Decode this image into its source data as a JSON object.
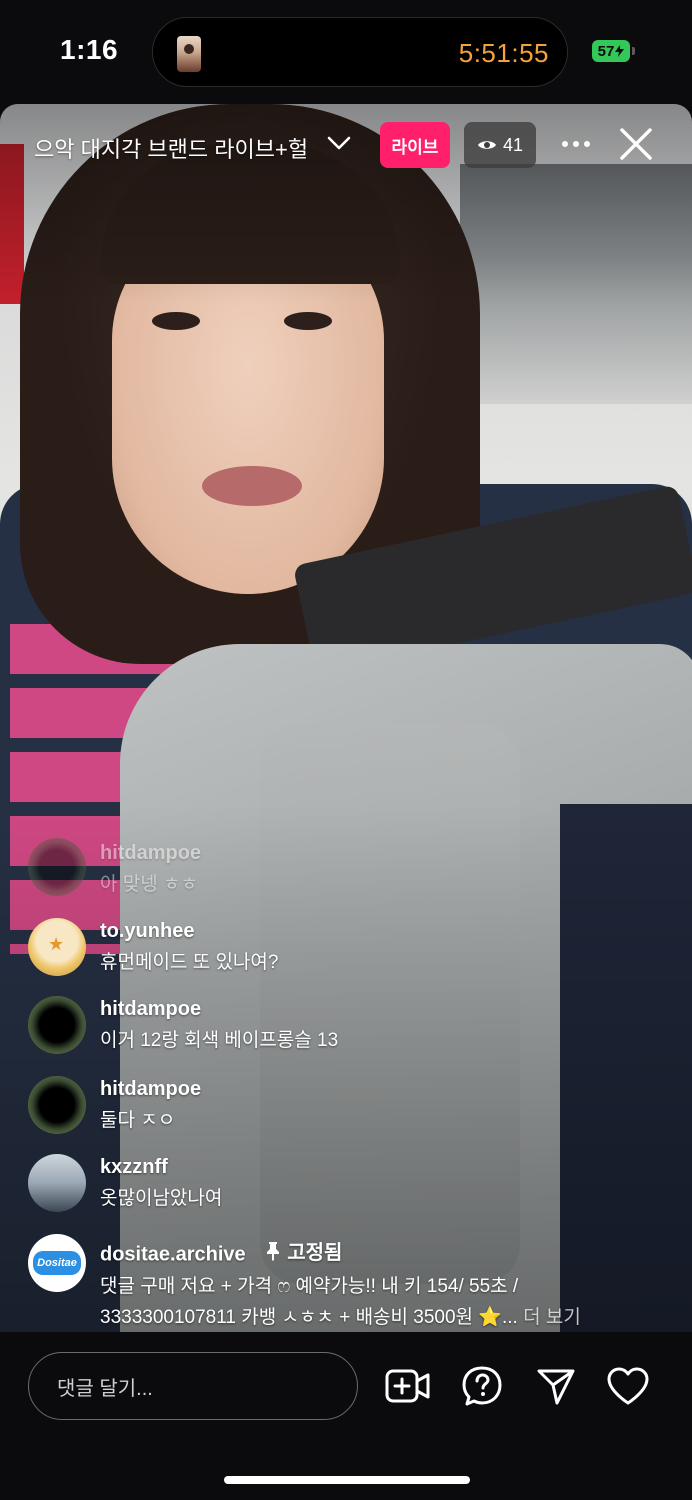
{
  "status_bar": {
    "time": "1:16",
    "activity_timer": "5:51:55",
    "battery_level": "57"
  },
  "live": {
    "title": "으악 대지각 브랜드 라이브+헐",
    "live_badge": "라이브",
    "viewer_count": "41",
    "accent_color": "#ff1f6b"
  },
  "comments": [
    {
      "username": "hitdampoe",
      "text": "아 맞넹 ㅎㅎ",
      "faded": true
    },
    {
      "username": "to.yunhee",
      "text": "휴먼메이드 또 있나여?"
    },
    {
      "username": "hitdampoe",
      "text": "이거 12랑 회색 베이프롱슬 13"
    },
    {
      "username": "hitdampoe",
      "text": "둘다 ㅈㅇ"
    },
    {
      "username": "kxzznff",
      "text": "옷많이남았나여"
    },
    {
      "username": "dositae.archive",
      "pinned_label": "고정됨",
      "text_line1": "댓글 구매 저요 + 가격 ෆ 예약가능!! 내 키 154/ 55초 /",
      "text_line2": "3333300107811 카뱅 ㅅㅎㅊ + 배송비 3500원 ⭐...",
      "more_label": "더 보기",
      "avatar_logo": "Dositae"
    }
  ],
  "bottom_bar": {
    "comment_placeholder": "댓글 달기..."
  },
  "icons": [
    "chevron-down-icon",
    "eye-icon",
    "more-icon",
    "close-icon",
    "pin-icon",
    "add-video-icon",
    "question-icon",
    "send-icon",
    "heart-icon"
  ]
}
